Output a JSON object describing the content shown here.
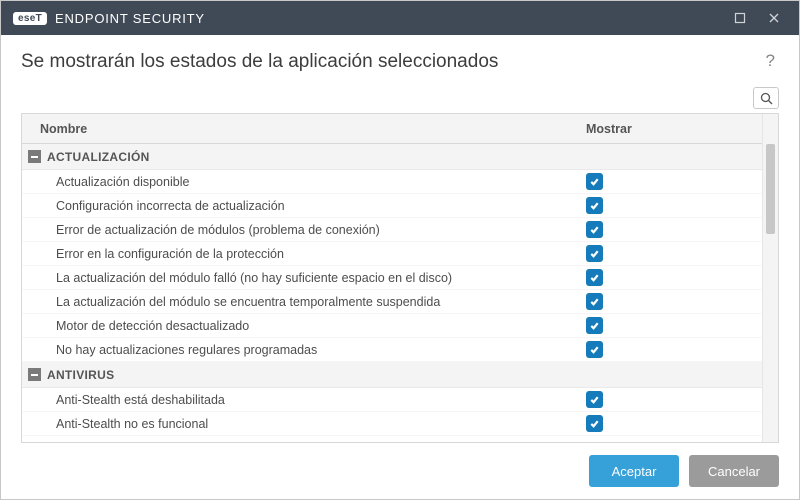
{
  "brand": {
    "badge": "eseT",
    "product": "ENDPOINT SECURITY"
  },
  "page_title": "Se mostrarán los estados de la aplicación seleccionados",
  "columns": {
    "name": "Nombre",
    "show": "Mostrar"
  },
  "groups": [
    {
      "label": "ACTUALIZACIÓN",
      "items": [
        {
          "label": "Actualización disponible",
          "checked": true
        },
        {
          "label": "Configuración incorrecta de actualización",
          "checked": true
        },
        {
          "label": "Error de actualización de módulos (problema de conexión)",
          "checked": true
        },
        {
          "label": "Error en la configuración de la protección",
          "checked": true
        },
        {
          "label": "La actualización del módulo falló (no hay suficiente espacio en el disco)",
          "checked": true
        },
        {
          "label": "La actualización del módulo se encuentra temporalmente suspendida",
          "checked": true
        },
        {
          "label": "Motor de detección desactualizado",
          "checked": true
        },
        {
          "label": "No hay actualizaciones regulares programadas",
          "checked": true
        }
      ]
    },
    {
      "label": "ANTIVIRUS",
      "items": [
        {
          "label": "Anti-Stealth está deshabilitada",
          "checked": true
        },
        {
          "label": "Anti-Stealth no es funcional",
          "checked": true
        }
      ]
    }
  ],
  "buttons": {
    "ok": "Aceptar",
    "cancel": "Cancelar"
  },
  "help": "?"
}
